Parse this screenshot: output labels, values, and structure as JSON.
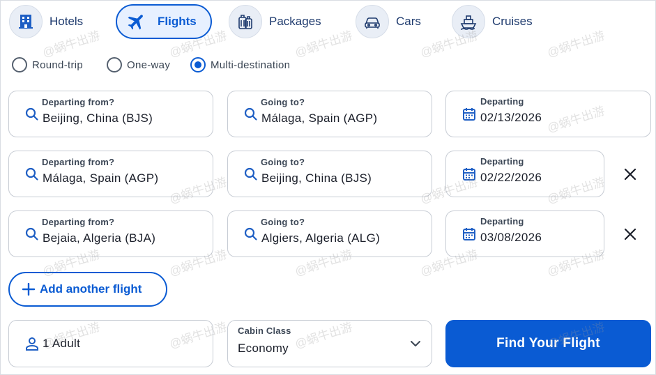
{
  "tabs": [
    {
      "label": "Hotels",
      "icon": "hotel-icon",
      "active": false
    },
    {
      "label": "Flights",
      "icon": "airplane-icon",
      "active": true
    },
    {
      "label": "Packages",
      "icon": "luggage-icon",
      "active": false
    },
    {
      "label": "Cars",
      "icon": "car-icon",
      "active": false
    },
    {
      "label": "Cruises",
      "icon": "cruise-ship-icon",
      "active": false
    }
  ],
  "trip_types": [
    {
      "label": "Round-trip",
      "checked": false
    },
    {
      "label": "One-way",
      "checked": false
    },
    {
      "label": "Multi-destination",
      "checked": true
    }
  ],
  "flights": [
    {
      "from_label": "Departing from?",
      "from": "Beijing, China (BJS)",
      "to_label": "Going to?",
      "to": "Málaga, Spain (AGP)",
      "date_label": "Departing",
      "date": "02/13/2026",
      "removable": false
    },
    {
      "from_label": "Departing from?",
      "from": "Málaga, Spain (AGP)",
      "to_label": "Going to?",
      "to": "Beijing, China (BJS)",
      "date_label": "Departing",
      "date": "02/22/2026",
      "removable": true
    },
    {
      "from_label": "Departing from?",
      "from": "Bejaia, Algeria (BJA)",
      "to_label": "Going to?",
      "to": "Algiers, Algeria (ALG)",
      "date_label": "Departing",
      "date": "03/08/2026",
      "removable": true
    }
  ],
  "add_flight_label": "Add another flight",
  "travellers": {
    "value": "1 Adult",
    "icon": "person-icon"
  },
  "cabin": {
    "label": "Cabin Class",
    "value": "Economy"
  },
  "search_button_label": "Find Your Flight",
  "watermark_text": "@蜗牛出游",
  "colors": {
    "accent": "#0a5bd3",
    "accent_light": "#e7f0ff",
    "border": "#c7ccd4",
    "text": "#1b1f2a"
  }
}
